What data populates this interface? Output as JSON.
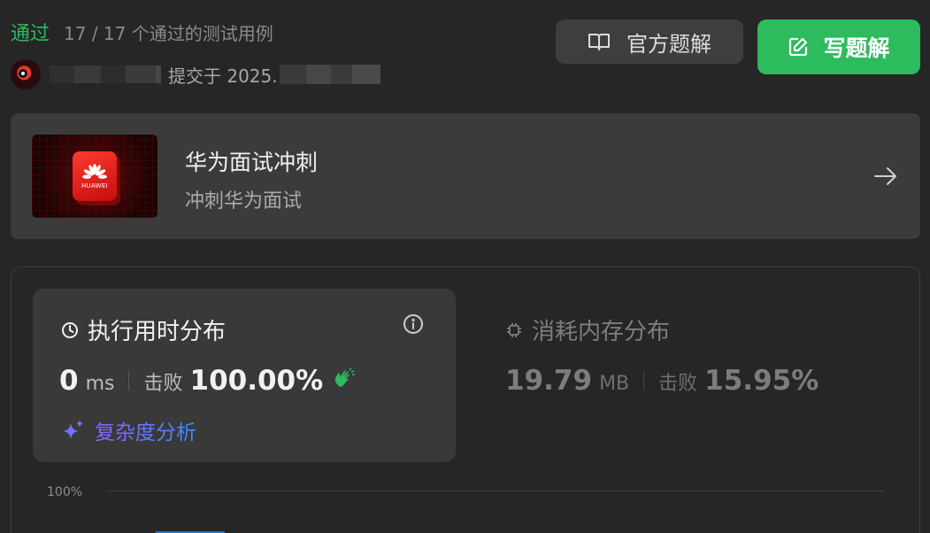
{
  "header": {
    "status": "通过",
    "test_count": "17 / 17 个通过的测试用例",
    "submitted_at": "提交于 2025.",
    "official_solution_label": "官方题解",
    "write_solution_label": "写题解"
  },
  "study_plan": {
    "title": "华为面试冲刺",
    "subtitle": "冲刺华为面试",
    "logo_text": "HUAWEI"
  },
  "runtime": {
    "title": "执行用时分布",
    "value": "0",
    "unit": "ms",
    "beats_label": "击败",
    "beats_value": "100.00%",
    "analysis_label": "复杂度分析"
  },
  "memory": {
    "title": "消耗内存分布",
    "value": "19.79",
    "unit": "MB",
    "beats_label": "击败",
    "beats_value": "15.95%"
  },
  "chart": {
    "y_top_label": "100%"
  },
  "colors": {
    "accent_green": "#2cbb5d",
    "background": "#262626",
    "card": "#3b3b3b"
  }
}
